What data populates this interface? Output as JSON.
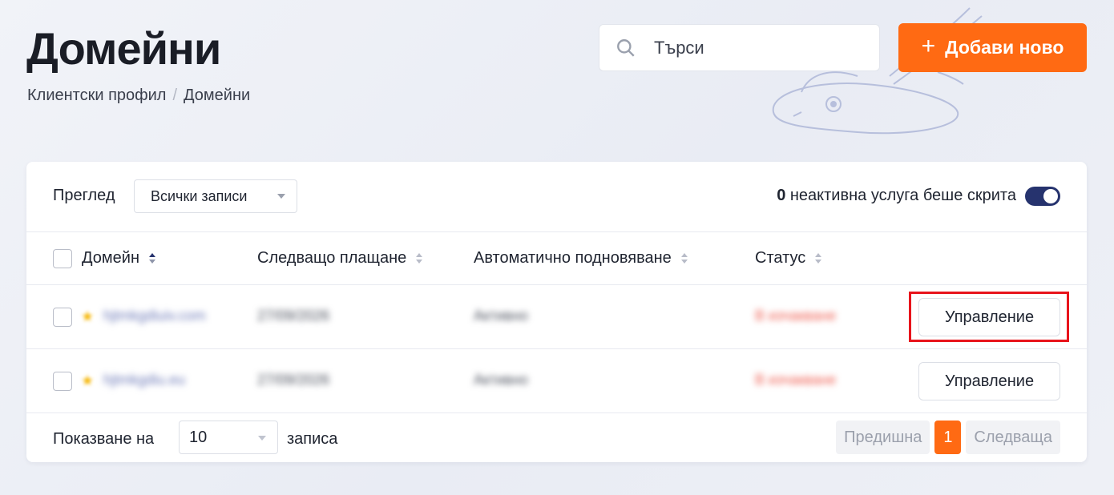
{
  "page": {
    "title": "Домейни",
    "breadcrumb": [
      "Клиентски профил",
      "Домейни"
    ]
  },
  "header": {
    "search_placeholder": "Търси",
    "add_button_label": "Добави ново"
  },
  "toolbar": {
    "view_label": "Преглед",
    "view_select_value": "Всички записи",
    "hidden_count": "0",
    "hidden_text": " неактивна услуга беше скрита",
    "toggle_on": true
  },
  "table": {
    "columns": [
      "Домейн",
      "Следващо плащане",
      "Автоматично подновяване",
      "Статус"
    ],
    "rows": [
      {
        "domain": "hjtmkgdiuiv.com",
        "next_payment": "27/09/2026",
        "auto_renew": "Активно",
        "status": "В изчакване",
        "action": "Управление"
      },
      {
        "domain": "hjtmkgdiu.eu",
        "next_payment": "27/09/2026",
        "auto_renew": "Активно",
        "status": "В изчакване",
        "action": "Управление"
      }
    ]
  },
  "footer": {
    "show_label": "Показване на",
    "per_page": "10",
    "records_label": "записа",
    "prev": "Предишна",
    "current_page": "1",
    "next": "Следваща"
  },
  "colors": {
    "accent": "#ff6a13",
    "toggle": "#26336e",
    "highlight": "#e8141c"
  }
}
